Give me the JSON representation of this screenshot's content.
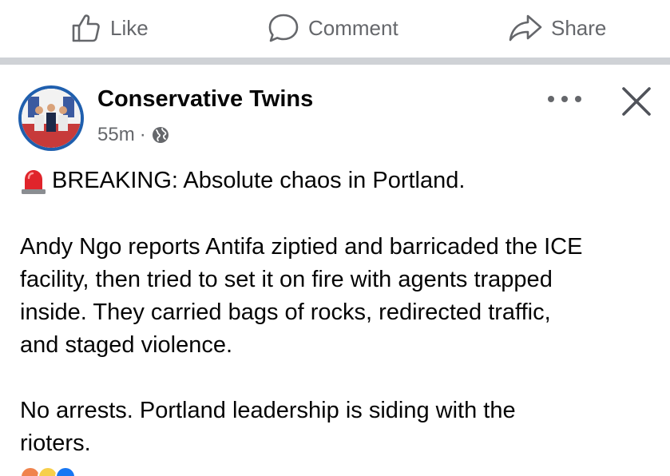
{
  "action_bar": {
    "like_label": "Like",
    "comment_label": "Comment",
    "share_label": "Share"
  },
  "post": {
    "author": "Conservative Twins",
    "time": "55m",
    "separator": "·",
    "headline": "BREAKING: Absolute chaos in Portland.",
    "body_lines": [
      "Andy Ngo reports Antifa ziptied and barricaded the ICE",
      "facility, then tried to set it on fire with agents trapped",
      "inside. They carried bags of rocks, redirected traffic,",
      "and staged violence."
    ],
    "closing_lines": [
      "No arrests. Portland leadership is siding with the",
      "rioters."
    ]
  },
  "icons": {
    "like": "thumbs-up-icon",
    "comment": "speech-bubble-icon",
    "share": "share-arrow-icon",
    "audience": "globe-icon",
    "more": "more-options-icon",
    "close": "close-icon",
    "siren": "siren-emoji-icon"
  },
  "colors": {
    "text_primary": "#050505",
    "text_secondary": "#65676b",
    "avatar_ring": "#1f5fae",
    "divider": "#cfd2d6",
    "siren_red": "#e0242b"
  }
}
